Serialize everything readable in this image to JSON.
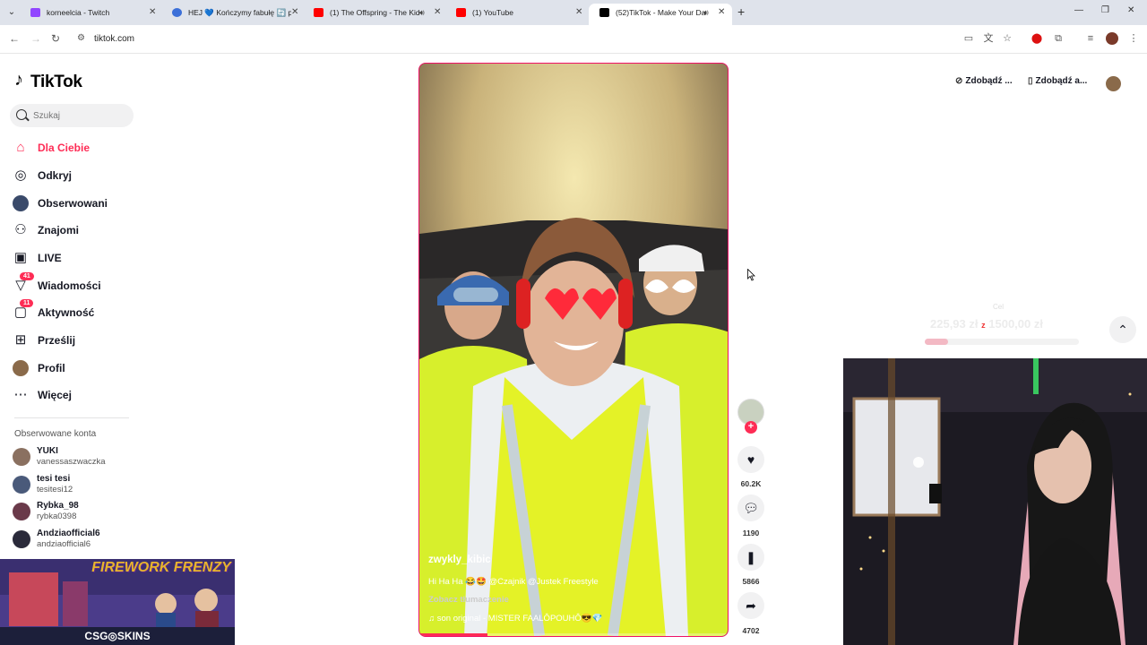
{
  "browser": {
    "tabs": [
      {
        "title": "korneelcia - Twitch",
        "favicon_color": "#9146ff",
        "active": false,
        "audio": false
      },
      {
        "title": "HEJ 💙 Kończymy fabułę 🔄 pr",
        "favicon_color": "#3b6fd8",
        "active": false,
        "audio": false
      },
      {
        "title": "(1) The Offspring - The Kid",
        "favicon_color": "#ff0000",
        "active": false,
        "audio": true
      },
      {
        "title": "(1) YouTube",
        "favicon_color": "#ff0000",
        "active": false,
        "audio": false
      },
      {
        "title": "(52)TikTok - Make Your Day",
        "favicon_color": "#000000",
        "active": true,
        "audio": true
      }
    ],
    "url": "tiktok.com"
  },
  "tiktok": {
    "logo_text": "TikTok",
    "search_placeholder": "Szukaj",
    "nav": [
      {
        "label": "Dla Ciebie",
        "icon": "home-icon",
        "active": true,
        "badge": ""
      },
      {
        "label": "Odkryj",
        "icon": "compass-icon",
        "active": false,
        "badge": ""
      },
      {
        "label": "Obserwowani",
        "icon": "following-avatar-icon",
        "active": false,
        "badge": ""
      },
      {
        "label": "Znajomi",
        "icon": "friends-icon",
        "active": false,
        "badge": ""
      },
      {
        "label": "LIVE",
        "icon": "live-icon",
        "active": false,
        "badge": ""
      },
      {
        "label": "Wiadomości",
        "icon": "messages-icon",
        "active": false,
        "badge": "41"
      },
      {
        "label": "Aktywność",
        "icon": "activity-icon",
        "active": false,
        "badge": "11"
      },
      {
        "label": "Prześlij",
        "icon": "upload-icon",
        "active": false,
        "badge": ""
      },
      {
        "label": "Profil",
        "icon": "profile-icon",
        "active": false,
        "badge": ""
      },
      {
        "label": "Więcej",
        "icon": "more-icon",
        "active": false,
        "badge": ""
      }
    ],
    "followed_title": "Obserwowane konta",
    "followed": [
      {
        "name": "YUKI",
        "user": "vanessaszwaczka",
        "color": "#8a7060"
      },
      {
        "name": "tesi tesi",
        "user": "tesitesi12",
        "color": "#4a5a7a"
      },
      {
        "name": "Rybka_98",
        "user": "rybka0398",
        "color": "#6a3a4a"
      },
      {
        "name": "Andziaofficial6",
        "user": "andziaofficial6",
        "color": "#2a2a3a"
      }
    ],
    "header": {
      "coins_label": "Zdobądź ...",
      "app_label": "Zdobądź a..."
    },
    "video": {
      "author": "zwykly_kibic",
      "description": "Hi Ha Ha 😂🤩 @Czajnik @Justek Freestyle",
      "translate": "Zobacz tłumaczenie",
      "music": "son original - MISTER FAALÔPOUHÔ😎💎",
      "progress": 0.22
    },
    "actions": {
      "likes": "60.2K",
      "comments": "1190",
      "saves": "5866",
      "shares": "4702"
    }
  },
  "overlay": {
    "goal_tag": "Cel",
    "goal_current": "225,93 zł",
    "goal_sep": "z",
    "goal_target": "1500,00 zł",
    "goal_progress": 0.15,
    "ad_title": "FIREWORK FRENZY",
    "ad_brand": "CSG◎SKINS"
  }
}
